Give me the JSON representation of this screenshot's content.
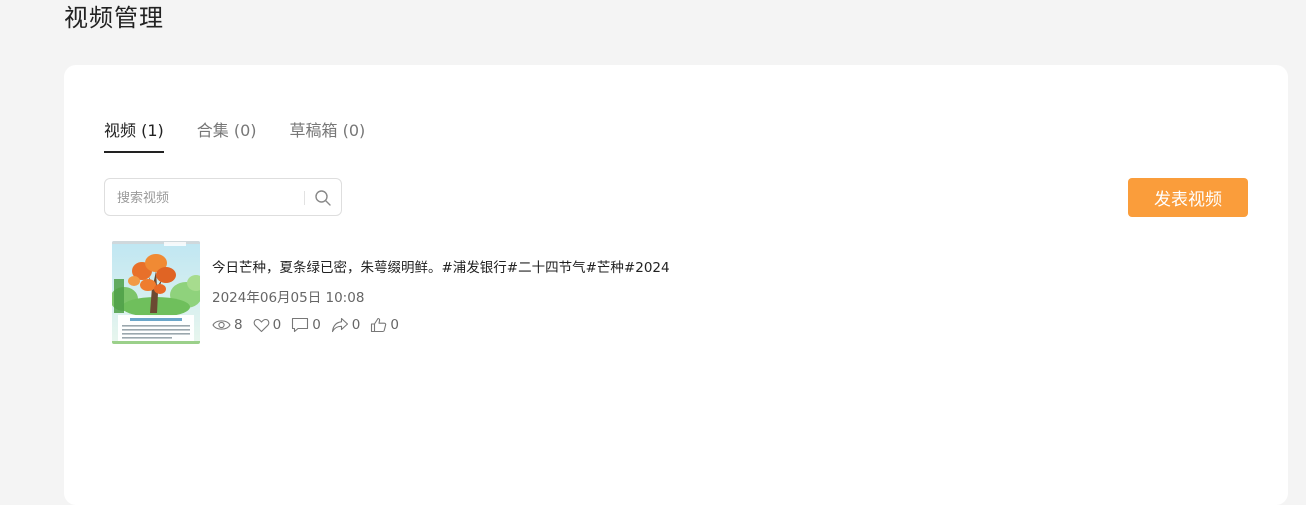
{
  "page": {
    "title": "视频管理"
  },
  "tabs": [
    {
      "label": "视频 (1)",
      "active": true
    },
    {
      "label": "合集 (0)",
      "active": false
    },
    {
      "label": "草稿箱 (0)",
      "active": false
    }
  ],
  "search": {
    "placeholder": "搜索视频",
    "value": ""
  },
  "publish_button": {
    "label": "发表视频",
    "color": "#fa9d3b"
  },
  "videos": [
    {
      "title": "今日芒种，夏条绿已密，朱萼缀明鲜。#浦发银行#二十四节气#芒种#2024",
      "date": "2024年06月05日 10:08",
      "stats": {
        "views": "8",
        "likes": "0",
        "comments": "0",
        "shares": "0",
        "thumbs_up": "0"
      },
      "thumbnail_icons": [
        "tree-illustration"
      ]
    }
  ],
  "colors": {
    "background": "#f4f4f4",
    "panel": "#ffffff",
    "accent": "#fa9d3b",
    "text_primary": "#222222",
    "text_secondary": "#666666"
  }
}
